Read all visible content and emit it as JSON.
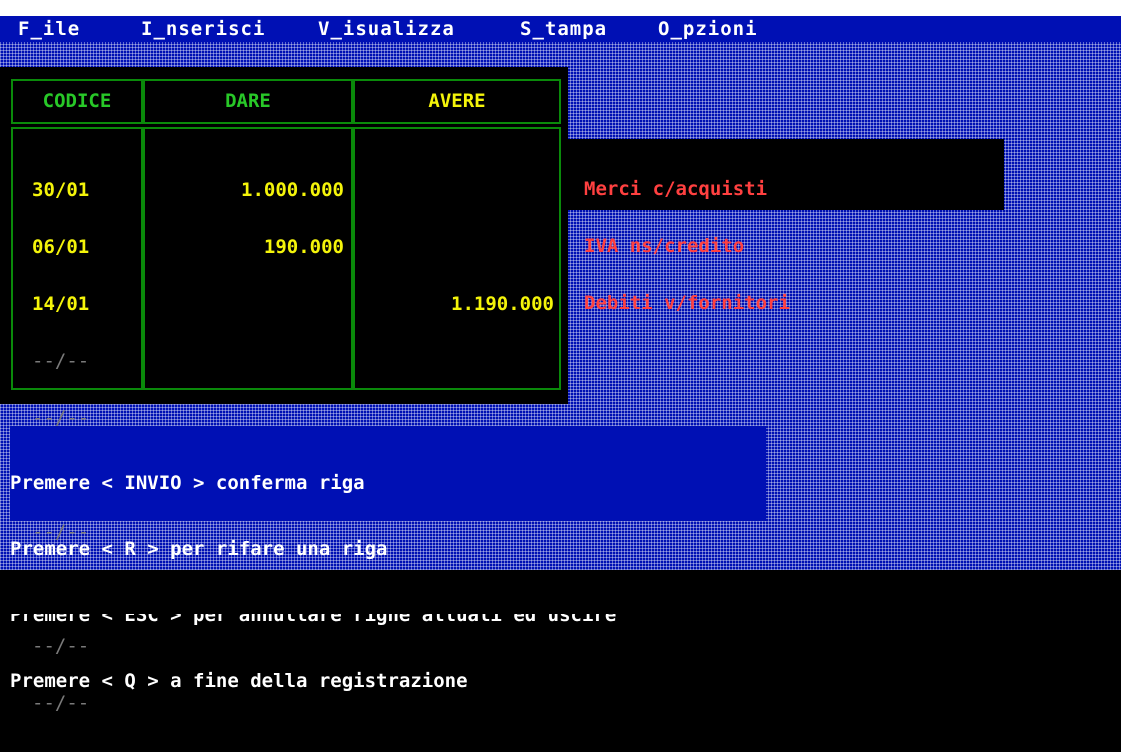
{
  "menu": [
    {
      "label": "F_ile"
    },
    {
      "label": "I_nserisci"
    },
    {
      "label": "V_isualizza"
    },
    {
      "label": "S_tampa"
    },
    {
      "label": "O_pzioni"
    }
  ],
  "table": {
    "headers": {
      "codice": "CODICE",
      "dare": "DARE",
      "avere": "AVERE"
    },
    "rows": [
      {
        "codice": "30/01",
        "dare": "1.000.000",
        "avere": ""
      },
      {
        "codice": "06/01",
        "dare": "190.000",
        "avere": ""
      },
      {
        "codice": "14/01",
        "dare": "",
        "avere": "1.190.000"
      }
    ],
    "empty_code": "--/--",
    "empty_rows": [
      "--/--",
      "--/--",
      "--/--",
      "--/--",
      "--/--",
      "--/--",
      "--/--"
    ]
  },
  "descriptions": [
    "Merci c/acquisti",
    "IVA ns/credito",
    "Debiti v/fornitori"
  ],
  "help": [
    "Premere < INVIO > conferma riga",
    "Premere < R > per rifare una riga",
    "Premere < ESC > per annullare righe attuali ed uscire",
    "Premere < Q > a fine della registrazione"
  ],
  "colors": {
    "background_blue": "#0010b4",
    "grid_green": "#0a8a0a",
    "header_green": "#28c828",
    "value_yellow": "#f4f40a",
    "description_red": "#ff4040"
  }
}
